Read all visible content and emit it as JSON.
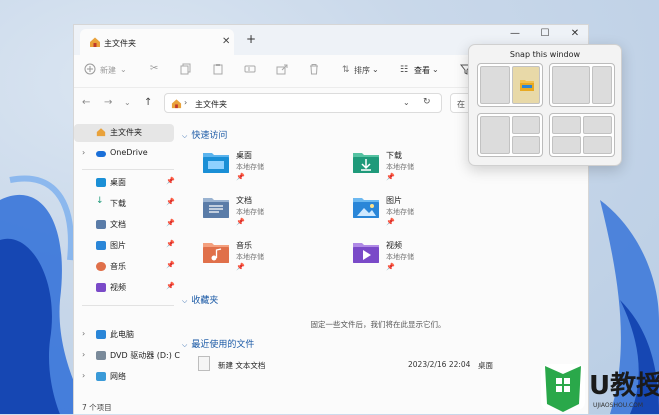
{
  "window": {
    "tab_title": "主文件夹",
    "new_tab": "+",
    "minimize": "—",
    "maximize": "☐",
    "close": "✕"
  },
  "toolbar": {
    "new_label": "新建",
    "sort_label": "排序",
    "view_label": "查看"
  },
  "address": {
    "path": "主文件夹",
    "search_prefix": "在"
  },
  "sidebar": {
    "items": [
      {
        "label": "主文件夹",
        "icon": "home-icon",
        "selected": true
      },
      {
        "label": "OneDrive",
        "icon": "cloud-icon"
      },
      {
        "label": "桌面",
        "icon": "desktop-icon",
        "pinned": true
      },
      {
        "label": "下载",
        "icon": "download-icon",
        "pinned": true
      },
      {
        "label": "文档",
        "icon": "document-icon",
        "pinned": true
      },
      {
        "label": "图片",
        "icon": "picture-icon",
        "pinned": true
      },
      {
        "label": "音乐",
        "icon": "music-icon",
        "pinned": true
      },
      {
        "label": "视频",
        "icon": "video-icon",
        "pinned": true
      },
      {
        "label": "此电脑",
        "icon": "pc-icon"
      },
      {
        "label": "DVD 驱动器 (D:) C",
        "icon": "dvd-icon"
      },
      {
        "label": "网络",
        "icon": "network-icon"
      }
    ]
  },
  "sections": {
    "quick_access": "快速访问",
    "favorites": "收藏夹",
    "recent": "最近使用的文件"
  },
  "quick_access": [
    {
      "name": "桌面",
      "sub": "本地存储",
      "color": "#1a8fd6"
    },
    {
      "name": "下载",
      "sub": "本地存储",
      "color": "#1f9a7a"
    },
    {
      "name": "文档",
      "sub": "本地存储",
      "color": "#5a7ca8"
    },
    {
      "name": "图片",
      "sub": "本地存储",
      "color": "#2a86d8"
    },
    {
      "name": "音乐",
      "sub": "本地存储",
      "color": "#e0704a"
    },
    {
      "name": "视频",
      "sub": "本地存储",
      "color": "#7a4ac8"
    }
  ],
  "favorites_empty": "固定一些文件后，我们将在此显示它们。",
  "recent_files": [
    {
      "name": "新建 文本文档",
      "date": "2023/2/16 22:04",
      "location": "桌面"
    }
  ],
  "status": {
    "count": "7 个项目"
  },
  "snap": {
    "title": "Snap this window"
  }
}
